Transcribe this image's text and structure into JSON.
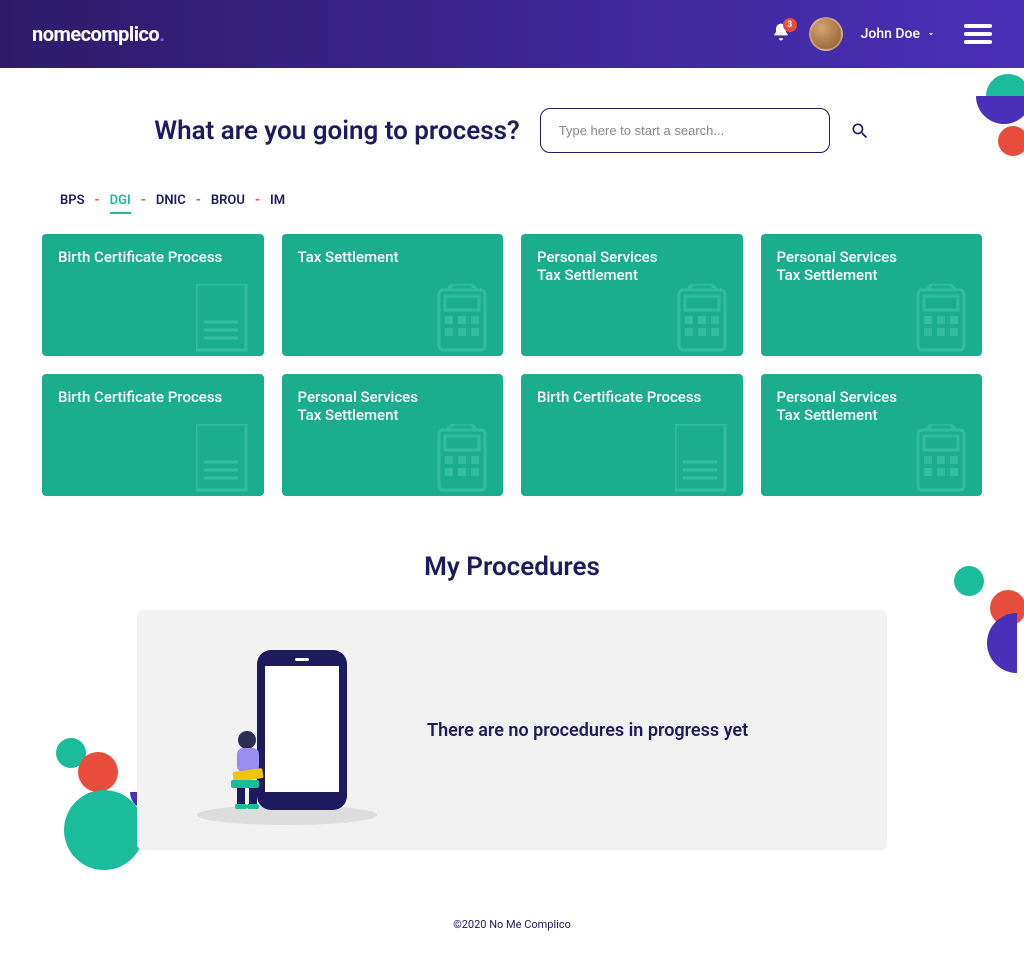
{
  "header": {
    "logo_text": "nomecomplico",
    "logo_dot": ".",
    "notification_count": "3",
    "username": "John Doe"
  },
  "search": {
    "title": "What are you going to process?",
    "placeholder": "Type here to start a search..."
  },
  "tabs": {
    "items": [
      "BPS",
      "DGI",
      "DNIC",
      "BROU",
      "IM"
    ],
    "active_index": 1
  },
  "cards": [
    {
      "title": "Birth Certificate Process",
      "icon": "doc"
    },
    {
      "title": "Tax Settlement",
      "icon": "calc"
    },
    {
      "title": "Personal Services\nTax Settlement",
      "icon": "calc"
    },
    {
      "title": "Personal Services\nTax Settlement",
      "icon": "calc"
    },
    {
      "title": "Birth Certificate Process",
      "icon": "doc"
    },
    {
      "title": "Personal Services\nTax Settlement",
      "icon": "calc"
    },
    {
      "title": "Birth Certificate Process",
      "icon": "doc"
    },
    {
      "title": "Personal Services\nTax Settlement",
      "icon": "calc"
    }
  ],
  "procedures": {
    "title": "My Procedures",
    "empty_text": "There are no procedures in progress yet"
  },
  "footer": {
    "copyright": "©2020 No Me Complico"
  }
}
